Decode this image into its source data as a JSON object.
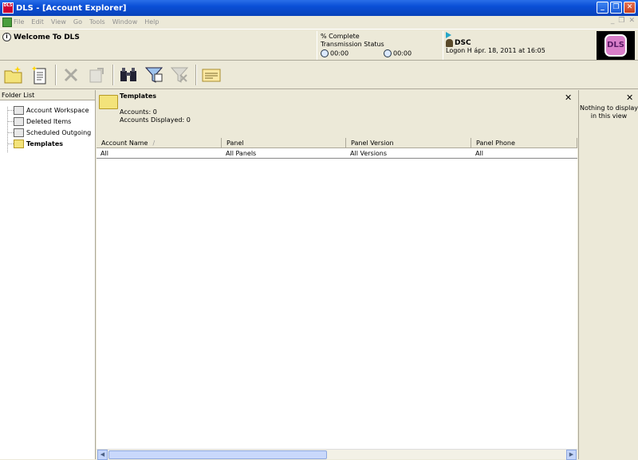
{
  "window": {
    "title": "DLS - [Account Explorer]",
    "app_icon_text": "DLS",
    "minimize": "_",
    "restore": "❐",
    "close": "✕"
  },
  "menu": {
    "items": [
      "File",
      "Edit",
      "View",
      "Go",
      "Tools",
      "Window",
      "Help"
    ],
    "mdi_min": "_",
    "mdi_restore": "❐",
    "mdi_close": "✕"
  },
  "status": {
    "welcome": "Welcome To DLS",
    "percent_complete": "% Complete",
    "transmission_status": "Transmission Status",
    "timer1": "00:00",
    "timer2": "00:00",
    "account_name": "DSC",
    "logon": "Logon H ápr. 18, 2011 at 16:05",
    "logo_text": "DLS"
  },
  "toolbar": {
    "buttons": [
      {
        "name": "new-folder",
        "icon": "folder-new-icon",
        "enabled": true
      },
      {
        "name": "new-account",
        "icon": "document-new-icon",
        "enabled": true
      },
      {
        "name": "delete",
        "icon": "delete-icon",
        "enabled": false
      },
      {
        "name": "properties",
        "icon": "properties-icon",
        "enabled": false
      },
      {
        "name": "find",
        "icon": "binoculars-icon",
        "enabled": true
      },
      {
        "name": "filter",
        "icon": "filter-icon",
        "enabled": true
      },
      {
        "name": "clear-filter",
        "icon": "clear-filter-icon",
        "enabled": false
      },
      {
        "name": "card",
        "icon": "card-icon",
        "enabled": true
      }
    ]
  },
  "folder_list": {
    "header": "Folder List",
    "items": [
      {
        "label": "Account Workspace",
        "icon": "workspace-icon",
        "selected": false
      },
      {
        "label": "Deleted Items",
        "icon": "deleted-items-icon",
        "selected": false
      },
      {
        "label": "Scheduled Outgoing",
        "icon": "scheduled-icon",
        "selected": false
      },
      {
        "label": "Templates",
        "icon": "folder-icon",
        "selected": true
      }
    ]
  },
  "main": {
    "title": "Templates",
    "accounts_count": "Accounts: 0",
    "accounts_displayed": "Accounts Displayed: 0",
    "close": "✕",
    "columns": [
      "Account Name",
      "Panel",
      "Panel Version",
      "Panel Phone"
    ],
    "sort_indicator": "/",
    "rows": [
      [
        "All",
        "All Panels",
        "All Versions",
        "All"
      ]
    ]
  },
  "right_pane": {
    "close": "✕",
    "message": "Nothing to display in this view"
  },
  "colors": {
    "titlebar": "#0a4fd6",
    "face": "#ece9d8",
    "logo": "#d97fc9"
  }
}
